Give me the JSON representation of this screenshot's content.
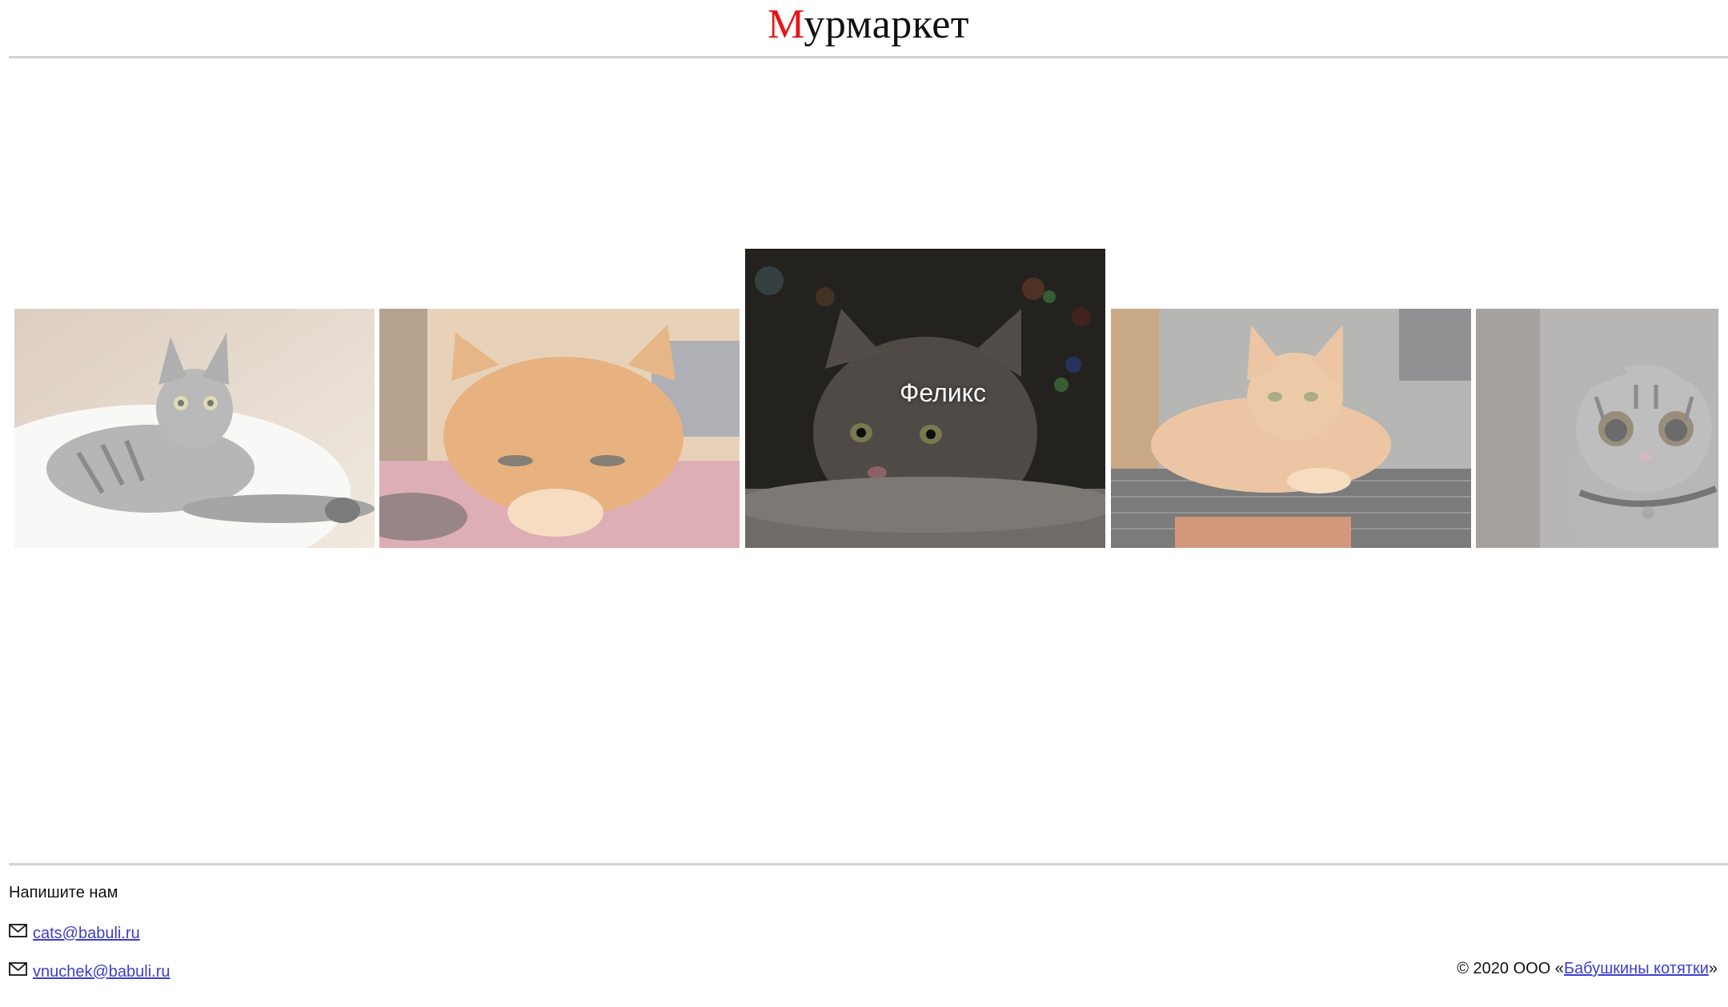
{
  "header": {
    "logo_first_letter": "М",
    "logo_rest": "урмаркет",
    "accent_color": "#e5151a"
  },
  "gallery": {
    "cards": [
      {
        "caption": "",
        "icon": "cat-photo-gray-tabby",
        "active": false
      },
      {
        "caption": "",
        "icon": "cat-photo-orange",
        "active": false
      },
      {
        "caption": "Феликс",
        "icon": "cat-photo-gray",
        "active": true
      },
      {
        "caption": "",
        "icon": "cat-photo-ginger",
        "active": false
      },
      {
        "caption": "",
        "icon": "cat-photo-tabby-kitten",
        "active": false
      }
    ]
  },
  "footer": {
    "contact_title": "Напишите нам",
    "emails": [
      "cats@babuli.ru",
      "vnuchek@babuli.ru"
    ],
    "copyright_prefix": "© 2020 ООО «",
    "company_link": "Бабушкины котятки",
    "copyright_suffix": "»",
    "link_color": "#3b3ecb"
  }
}
